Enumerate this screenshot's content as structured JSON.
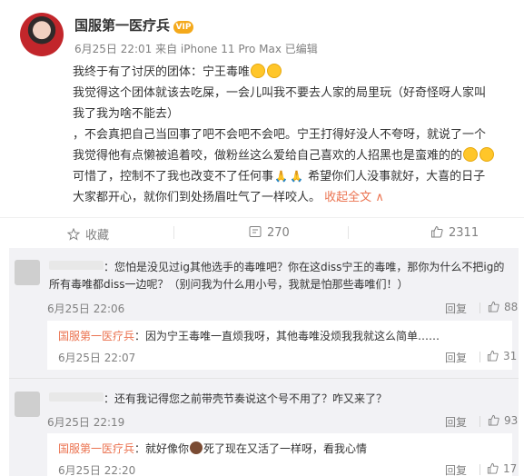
{
  "post": {
    "author": "国服第一医疗兵",
    "vip_badge": "VIP",
    "meta": "6月25日 22:01 来自 iPhone 11 Pro Max  已编辑",
    "lines": [
      {
        "text": "我终于有了讨厌的团体：宁王毒唯",
        "emoji": "grin"
      },
      {
        "text": "我觉得这个团体就该去吃屎，一会儿叫我不要去人家的局里玩（好奇怪呀人家叫",
        "emoji": ""
      },
      {
        "text": "我了我为啥不能去）",
        "emoji": ""
      },
      {
        "text": "，不会真把自己当回事了吧不会吧不会吧。宁王打得好没人不夸呀，就说了一个",
        "emoji": ""
      },
      {
        "text": "我觉得他有点懒被追着咬，做粉丝这么爱给自己喜欢的人招黑也是蛮难的的",
        "emoji": "grin"
      },
      {
        "text": "可惜了，控制不了我也改变不了任何事",
        "emoji": "pray"
      },
      {
        "text": "大家都开心，就你们到处扬眉吐气了一样咬人。",
        "emoji": ""
      }
    ],
    "line6_suffix": "希望你们人没事就好，大喜的日子",
    "fulltext_label": "收起全文",
    "fulltext_arrow": "∧"
  },
  "actions": {
    "favorite_label": "收藏",
    "repost_count": "270",
    "like_count": "2311"
  },
  "comments": [
    {
      "text_line1": "：您怕是没见过ig其他选手的毒唯吧？你在这diss宁王的毒唯，那你为什么不把ig的",
      "text_line2": "所有毒唯都diss一边呢？（别问我为什么用小号，我就是怕那些毒唯们！）",
      "time": "6月25日 22:06",
      "reply_label": "回复",
      "like_count": "88"
    },
    {
      "reply_author": "国服第一医疗兵",
      "reply_text": "：因为宁王毒唯一直烦我呀，其他毒唯没烦我我就这么简单……",
      "time": "6月25日 22:07",
      "reply_label": "回复",
      "like_count": "31"
    },
    {
      "text_line1": "：还有我记得您之前带壳节奏说这个号不用了？咋又来了？",
      "time": "6月25日 22:19",
      "reply_label": "回复",
      "like_count": "93"
    },
    {
      "reply_author": "国服第一医疗兵",
      "reply_text_a": "：就好像你",
      "reply_text_b": "死了现在又活了一样呀，看我心情",
      "time": "6月25日 22:20",
      "reply_label": "回复",
      "like_count": "17"
    }
  ],
  "colors": {
    "accent": "#eb7350",
    "muted": "#808080",
    "comment_bg": "#f2f2f5"
  },
  "icons": [
    "grin-emoji",
    "pray-emoji",
    "star-icon",
    "repost-icon",
    "thumbs-up-icon",
    "vip-badge-icon"
  ]
}
